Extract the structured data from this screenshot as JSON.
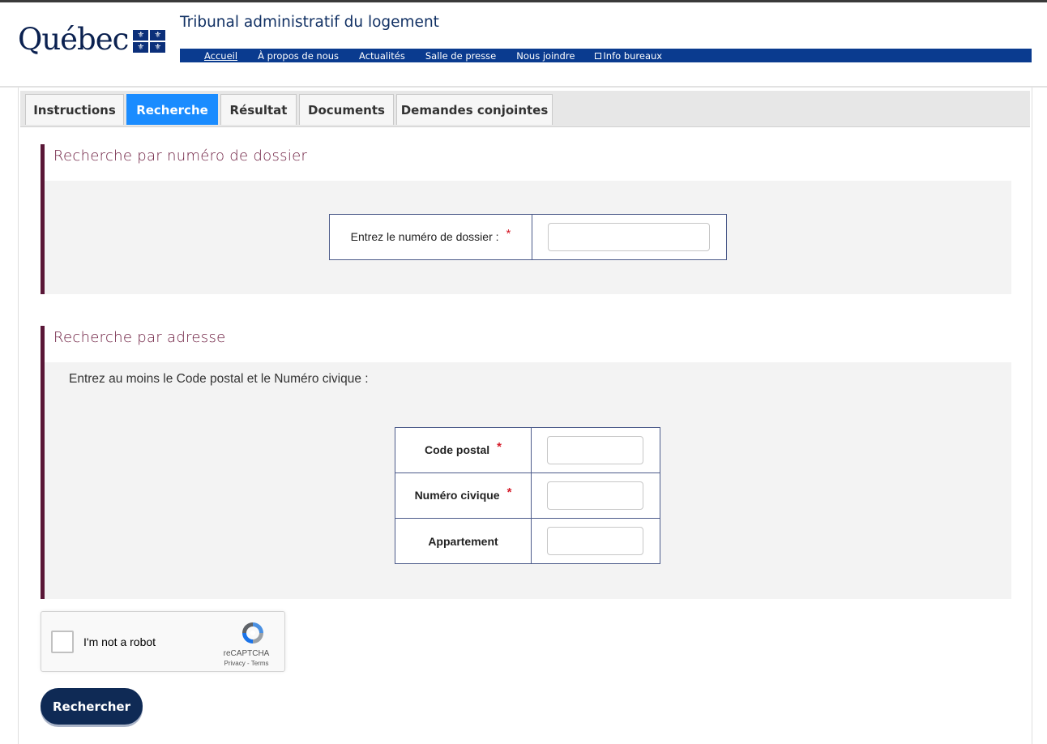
{
  "header": {
    "logo_word": "Québec",
    "flag_symbol": "⚜",
    "site_title": "Tribunal administratif du logement",
    "nav": [
      "Accueil",
      "À propos de nous",
      "Actualités",
      "Salle de presse",
      "Nous joindre",
      "Info bureaux"
    ]
  },
  "tabs": [
    "Instructions",
    "Recherche",
    "Résultat",
    "Documents",
    "Demandes conjointes"
  ],
  "dossier": {
    "title": "Recherche par numéro de dossier",
    "label": "Entrez le numéro de dossier :",
    "required_mark": "*",
    "value": ""
  },
  "adresse": {
    "title": "Recherche par adresse",
    "instruction": "Entrez au moins le Code postal et le Numéro civique :",
    "fields": {
      "code_postal": "Code postal",
      "numero_civique": "Numéro civique",
      "appartement": "Appartement"
    },
    "required_mark": "*"
  },
  "captcha": {
    "label": "I'm not a robot",
    "brand": "reCAPTCHA",
    "terms": "Privacy - Terms"
  },
  "submit_label": "Rechercher",
  "colors": {
    "nav_bar": "#0a3b8f",
    "active_tab": "#1a8cff",
    "section_accent": "#5a1737",
    "button": "#0f2a55",
    "required": "#d51c2a"
  }
}
